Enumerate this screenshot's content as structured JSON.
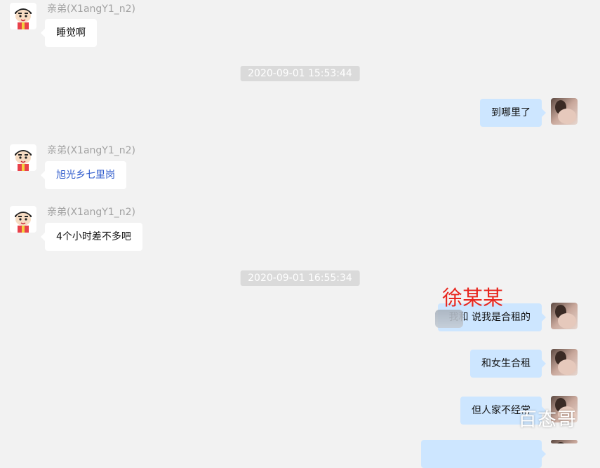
{
  "contact": {
    "name": "亲弟(X1angY1_n2)"
  },
  "messages": [
    {
      "text": "睡觉啊"
    },
    {
      "text": "到哪里了"
    },
    {
      "text": "旭光乡七里岗"
    },
    {
      "text": "4个小时差不多吧"
    },
    {
      "text": "我和 说我是合租的"
    },
    {
      "text": "和女生合租"
    },
    {
      "text": "但人家不经常"
    }
  ],
  "timestamps": [
    "2020-09-01 15:53:44",
    "2020-09-01 16:55:34"
  ],
  "annotation": {
    "label": "徐某某",
    "color": "#e8261e"
  },
  "watermark": {
    "text": "百态哥"
  },
  "colors": {
    "background": "#f2f2f2",
    "incoming_bubble": "#ffffff",
    "outgoing_bubble": "#cde6ff",
    "timestamp_bg": "#dadada",
    "link_text": "#2f5bcc"
  },
  "icons": {
    "contact_avatar": "cartoon-boy-avatar-icon",
    "self_avatar": "photo-avatar-icon"
  }
}
